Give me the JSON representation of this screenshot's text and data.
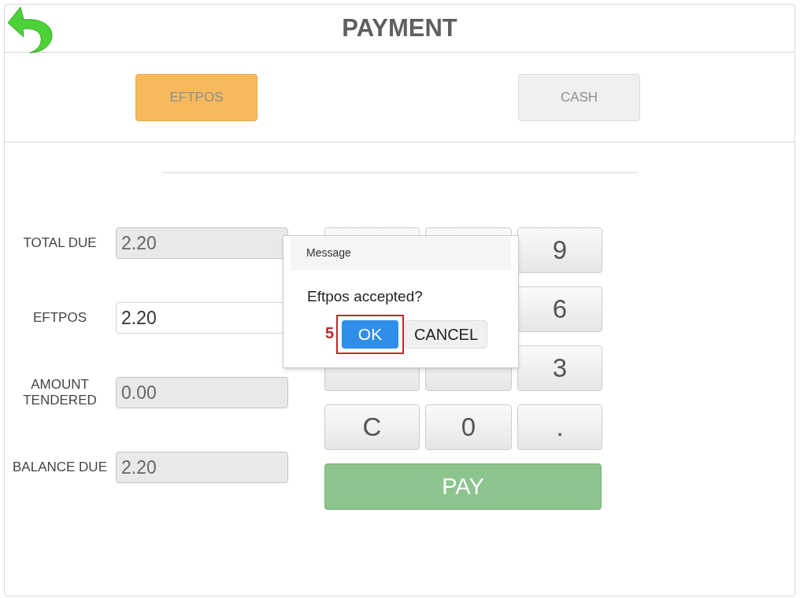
{
  "header": {
    "title": "PAYMENT"
  },
  "tabs": [
    {
      "label": "EFTPOS",
      "selected": true
    },
    {
      "label": "CASH",
      "selected": false
    }
  ],
  "fields": [
    {
      "label": "TOTAL DUE",
      "value": "2.20",
      "disabled": true
    },
    {
      "label": "EFTPOS",
      "value": "2.20",
      "disabled": false
    },
    {
      "label": "AMOUNT TENDERED",
      "value": "0.00",
      "disabled": true
    },
    {
      "label": "BALANCE DUE",
      "value": "2.20",
      "disabled": true
    }
  ],
  "keypad": [
    {
      "kind": "covered"
    },
    {
      "kind": "covered"
    },
    {
      "kind": "key",
      "label": "9"
    },
    {
      "kind": "hidden"
    },
    {
      "kind": "hidden"
    },
    {
      "kind": "key",
      "label": "6"
    },
    {
      "kind": "covered"
    },
    {
      "kind": "covered"
    },
    {
      "kind": "key",
      "label": "3"
    },
    {
      "kind": "key",
      "label": "C"
    },
    {
      "kind": "key",
      "label": "0"
    },
    {
      "kind": "key",
      "label": "."
    }
  ],
  "pay_button": {
    "label": "PAY"
  },
  "dialog": {
    "title": "Message",
    "message": "Eftpos accepted?",
    "buttons": [
      {
        "label": "OK",
        "kind": "primary"
      },
      {
        "label": "CANCEL",
        "kind": "secondary"
      }
    ],
    "annotation": "5"
  }
}
